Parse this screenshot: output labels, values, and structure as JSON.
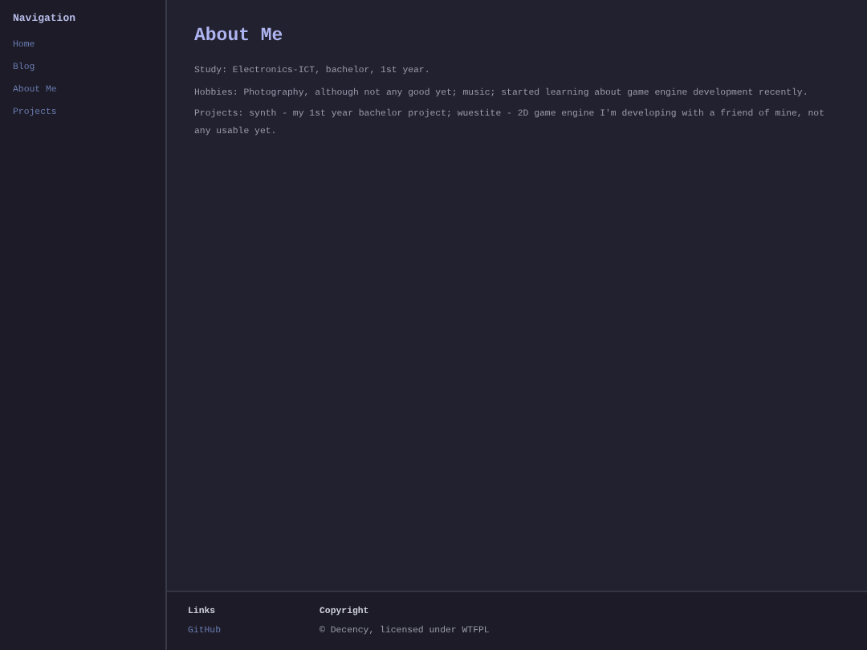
{
  "sidebar": {
    "title": "Navigation",
    "items": [
      {
        "label": "Home"
      },
      {
        "label": "Blog"
      },
      {
        "label": "About Me"
      },
      {
        "label": "Projects"
      }
    ]
  },
  "main": {
    "heading": "About Me",
    "paragraphs": [
      "Study: Electronics-ICT, bachelor, 1st year.",
      "Hobbies: Photography, although not any good yet; music; started learning about game engine development recently.",
      "Projects: synth - my 1st year bachelor project; wuestite - 2D game engine I'm developing with a friend of mine, not any usable yet."
    ]
  },
  "footer": {
    "links_title": "Links",
    "links": [
      {
        "label": "GitHub"
      }
    ],
    "copyright_title": "Copyright",
    "copyright": "© Decency, licensed under WTFPL"
  }
}
